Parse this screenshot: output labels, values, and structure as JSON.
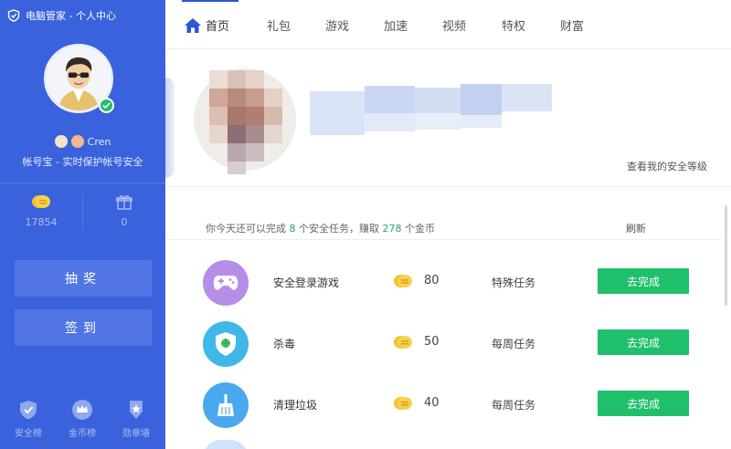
{
  "sidebar": {
    "title": "电脑管家 - 个人中心",
    "username": "Cren",
    "account_desc": "帐号宝 - 实时保护帐号安全",
    "stats": [
      {
        "icon": "coin-icon",
        "value": "17854"
      },
      {
        "icon": "gift-icon",
        "value": "0"
      }
    ],
    "lottery_label": "抽奖",
    "checkin_label": "签到",
    "bottom_items": [
      {
        "icon": "shield-icon",
        "label": "安全榜"
      },
      {
        "icon": "crown-icon",
        "label": "金币榜"
      },
      {
        "icon": "medal-icon",
        "label": "勋章墙"
      }
    ]
  },
  "nav": {
    "tabs": [
      {
        "label": "首页",
        "active": true
      },
      {
        "label": "礼包"
      },
      {
        "label": "游戏"
      },
      {
        "label": "加速"
      },
      {
        "label": "视频"
      },
      {
        "label": "特权"
      },
      {
        "label": "财富"
      }
    ]
  },
  "banner": {
    "safety_link": "查看我的安全等级"
  },
  "tasks": {
    "summary_prefix": "你今天还可以完成",
    "count": "8",
    "summary_mid": "个安全任务，赚取",
    "coins": "278",
    "summary_suffix": "个金币",
    "refresh_label": "刷新",
    "items": [
      {
        "icon": "gamepad-icon",
        "name": "安全登录游戏",
        "reward": "80",
        "type": "特殊任务",
        "button": "去完成"
      },
      {
        "icon": "antivirus-icon",
        "name": "杀毒",
        "reward": "50",
        "type": "每周任务",
        "button": "去完成"
      },
      {
        "icon": "broom-icon",
        "name": "清理垃圾",
        "reward": "40",
        "type": "每周任务",
        "button": "去完成"
      }
    ]
  },
  "colors": {
    "sidebar_bg": "#3a62dc",
    "accent": "#2c56d6",
    "success": "#1fbf6b",
    "highlight_num": "#2aa36a"
  }
}
